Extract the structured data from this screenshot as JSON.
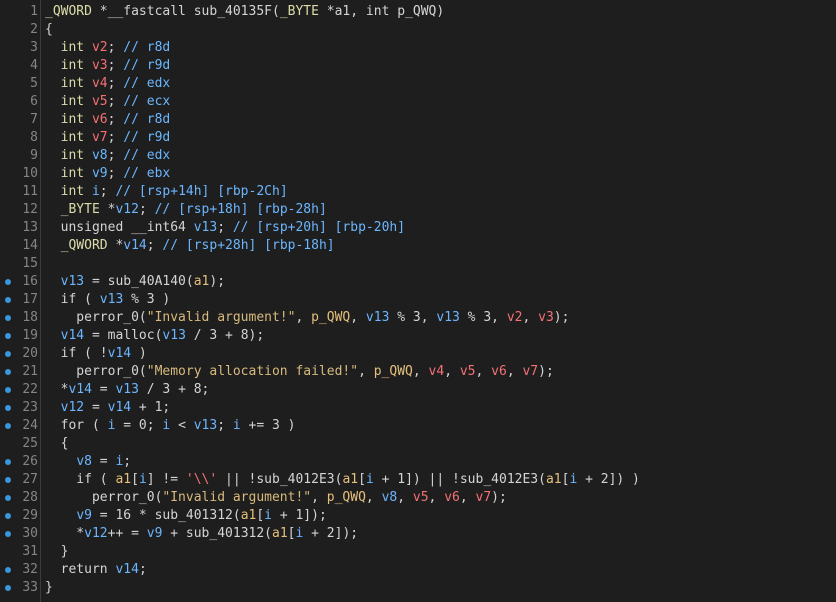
{
  "colors": {
    "background": "#1e1e1e",
    "line_number": "#858585",
    "breakpoint_dot": "#3a96dd",
    "keyword": "#dcdcaa",
    "local_var": "#6cb6ff",
    "argument": "#e5c07b",
    "register_var": "#f47174",
    "string": "#d7ba7d"
  },
  "lines": [
    {
      "n": "1",
      "dot": false,
      "tokens": [
        [
          "typ",
          "_QWORD"
        ],
        [
          "plain",
          " *__fastcall sub_40135F("
        ],
        [
          "typ",
          "_BYTE"
        ],
        [
          "plain",
          " *a1, int p_QWQ)"
        ]
      ]
    },
    {
      "n": "2",
      "dot": false,
      "tokens": [
        [
          "plain",
          "{"
        ]
      ]
    },
    {
      "n": "3",
      "dot": false,
      "tokens": [
        [
          "plain",
          "  "
        ],
        [
          "kw",
          "int"
        ],
        [
          "plain",
          " "
        ],
        [
          "reg",
          "v2"
        ],
        [
          "plain",
          "; "
        ],
        [
          "com",
          "// r8d"
        ]
      ]
    },
    {
      "n": "4",
      "dot": false,
      "tokens": [
        [
          "plain",
          "  "
        ],
        [
          "kw",
          "int"
        ],
        [
          "plain",
          " "
        ],
        [
          "reg",
          "v3"
        ],
        [
          "plain",
          "; "
        ],
        [
          "com",
          "// r9d"
        ]
      ]
    },
    {
      "n": "5",
      "dot": false,
      "tokens": [
        [
          "plain",
          "  "
        ],
        [
          "kw",
          "int"
        ],
        [
          "plain",
          " "
        ],
        [
          "reg",
          "v4"
        ],
        [
          "plain",
          "; "
        ],
        [
          "com",
          "// edx"
        ]
      ]
    },
    {
      "n": "6",
      "dot": false,
      "tokens": [
        [
          "plain",
          "  "
        ],
        [
          "kw",
          "int"
        ],
        [
          "plain",
          " "
        ],
        [
          "reg",
          "v5"
        ],
        [
          "plain",
          "; "
        ],
        [
          "com",
          "// ecx"
        ]
      ]
    },
    {
      "n": "7",
      "dot": false,
      "tokens": [
        [
          "plain",
          "  "
        ],
        [
          "kw",
          "int"
        ],
        [
          "plain",
          " "
        ],
        [
          "reg",
          "v6"
        ],
        [
          "plain",
          "; "
        ],
        [
          "com",
          "// r8d"
        ]
      ]
    },
    {
      "n": "8",
      "dot": false,
      "tokens": [
        [
          "plain",
          "  "
        ],
        [
          "kw",
          "int"
        ],
        [
          "plain",
          " "
        ],
        [
          "reg",
          "v7"
        ],
        [
          "plain",
          "; "
        ],
        [
          "com",
          "// r9d"
        ]
      ]
    },
    {
      "n": "9",
      "dot": false,
      "tokens": [
        [
          "plain",
          "  "
        ],
        [
          "kw",
          "int"
        ],
        [
          "plain",
          " "
        ],
        [
          "var",
          "v8"
        ],
        [
          "plain",
          "; "
        ],
        [
          "com",
          "// edx"
        ]
      ]
    },
    {
      "n": "10",
      "dot": false,
      "tokens": [
        [
          "plain",
          "  "
        ],
        [
          "kw",
          "int"
        ],
        [
          "plain",
          " "
        ],
        [
          "var",
          "v9"
        ],
        [
          "plain",
          "; "
        ],
        [
          "com",
          "// ebx"
        ]
      ]
    },
    {
      "n": "11",
      "dot": false,
      "tokens": [
        [
          "plain",
          "  "
        ],
        [
          "kw",
          "int"
        ],
        [
          "plain",
          " "
        ],
        [
          "var",
          "i"
        ],
        [
          "plain",
          "; "
        ],
        [
          "com",
          "// [rsp+14h] [rbp-2Ch]"
        ]
      ]
    },
    {
      "n": "12",
      "dot": false,
      "tokens": [
        [
          "plain",
          "  "
        ],
        [
          "typ",
          "_BYTE"
        ],
        [
          "plain",
          " *"
        ],
        [
          "var",
          "v12"
        ],
        [
          "plain",
          "; "
        ],
        [
          "com",
          "// [rsp+18h] [rbp-28h]"
        ]
      ]
    },
    {
      "n": "13",
      "dot": false,
      "tokens": [
        [
          "plain",
          "  unsigned __int64 "
        ],
        [
          "var",
          "v13"
        ],
        [
          "plain",
          "; "
        ],
        [
          "com",
          "// [rsp+20h] [rbp-20h]"
        ]
      ]
    },
    {
      "n": "14",
      "dot": false,
      "tokens": [
        [
          "plain",
          "  "
        ],
        [
          "typ",
          "_QWORD"
        ],
        [
          "plain",
          " *"
        ],
        [
          "var",
          "v14"
        ],
        [
          "plain",
          "; "
        ],
        [
          "com",
          "// [rsp+28h] [rbp-18h]"
        ]
      ]
    },
    {
      "n": "15",
      "dot": false,
      "tokens": [
        [
          "plain",
          ""
        ]
      ]
    },
    {
      "n": "16",
      "dot": true,
      "tokens": [
        [
          "plain",
          "  "
        ],
        [
          "var",
          "v13"
        ],
        [
          "plain",
          " = sub_40A140("
        ],
        [
          "arg",
          "a1"
        ],
        [
          "plain",
          ");"
        ]
      ]
    },
    {
      "n": "17",
      "dot": true,
      "tokens": [
        [
          "plain",
          "  if ( "
        ],
        [
          "var",
          "v13"
        ],
        [
          "plain",
          " % 3 )"
        ]
      ]
    },
    {
      "n": "18",
      "dot": true,
      "tokens": [
        [
          "plain",
          "    perror_0("
        ],
        [
          "str",
          "\"Invalid argument!\""
        ],
        [
          "plain",
          ", "
        ],
        [
          "arg",
          "p_QWQ"
        ],
        [
          "plain",
          ", "
        ],
        [
          "var",
          "v13"
        ],
        [
          "plain",
          " % 3, "
        ],
        [
          "var",
          "v13"
        ],
        [
          "plain",
          " % 3, "
        ],
        [
          "reg",
          "v2"
        ],
        [
          "plain",
          ", "
        ],
        [
          "reg",
          "v3"
        ],
        [
          "plain",
          ");"
        ]
      ]
    },
    {
      "n": "19",
      "dot": true,
      "tokens": [
        [
          "plain",
          "  "
        ],
        [
          "var",
          "v14"
        ],
        [
          "plain",
          " = malloc("
        ],
        [
          "var",
          "v13"
        ],
        [
          "plain",
          " / 3 + 8);"
        ]
      ]
    },
    {
      "n": "20",
      "dot": true,
      "tokens": [
        [
          "plain",
          "  if ( !"
        ],
        [
          "var",
          "v14"
        ],
        [
          "plain",
          " )"
        ]
      ]
    },
    {
      "n": "21",
      "dot": true,
      "tokens": [
        [
          "plain",
          "    perror_0("
        ],
        [
          "str",
          "\"Memory allocation failed!\""
        ],
        [
          "plain",
          ", "
        ],
        [
          "arg",
          "p_QWQ"
        ],
        [
          "plain",
          ", "
        ],
        [
          "reg",
          "v4"
        ],
        [
          "plain",
          ", "
        ],
        [
          "reg",
          "v5"
        ],
        [
          "plain",
          ", "
        ],
        [
          "reg",
          "v6"
        ],
        [
          "plain",
          ", "
        ],
        [
          "reg",
          "v7"
        ],
        [
          "plain",
          ");"
        ]
      ]
    },
    {
      "n": "22",
      "dot": true,
      "tokens": [
        [
          "plain",
          "  *"
        ],
        [
          "var",
          "v14"
        ],
        [
          "plain",
          " = "
        ],
        [
          "var",
          "v13"
        ],
        [
          "plain",
          " / 3 + 8;"
        ]
      ]
    },
    {
      "n": "23",
      "dot": true,
      "tokens": [
        [
          "plain",
          "  "
        ],
        [
          "var",
          "v12"
        ],
        [
          "plain",
          " = "
        ],
        [
          "var",
          "v14"
        ],
        [
          "plain",
          " + 1;"
        ]
      ]
    },
    {
      "n": "24",
      "dot": true,
      "tokens": [
        [
          "plain",
          "  for ( "
        ],
        [
          "var",
          "i"
        ],
        [
          "plain",
          " = 0; "
        ],
        [
          "var",
          "i"
        ],
        [
          "plain",
          " < "
        ],
        [
          "var",
          "v13"
        ],
        [
          "plain",
          "; "
        ],
        [
          "var",
          "i"
        ],
        [
          "plain",
          " += 3 )"
        ]
      ]
    },
    {
      "n": "25",
      "dot": false,
      "tokens": [
        [
          "plain",
          "  {"
        ]
      ]
    },
    {
      "n": "26",
      "dot": true,
      "tokens": [
        [
          "plain",
          "    "
        ],
        [
          "var",
          "v8"
        ],
        [
          "plain",
          " = "
        ],
        [
          "var",
          "i"
        ],
        [
          "plain",
          ";"
        ]
      ]
    },
    {
      "n": "27",
      "dot": true,
      "tokens": [
        [
          "plain",
          "    if ( "
        ],
        [
          "arg",
          "a1"
        ],
        [
          "plain",
          "["
        ],
        [
          "var",
          "i"
        ],
        [
          "plain",
          "] != "
        ],
        [
          "chr",
          "'\\\\'"
        ],
        [
          "plain",
          " || !sub_4012E3("
        ],
        [
          "arg",
          "a1"
        ],
        [
          "plain",
          "["
        ],
        [
          "var",
          "i"
        ],
        [
          "plain",
          " + 1]) || !sub_4012E3("
        ],
        [
          "arg",
          "a1"
        ],
        [
          "plain",
          "["
        ],
        [
          "var",
          "i"
        ],
        [
          "plain",
          " + 2]) )"
        ]
      ]
    },
    {
      "n": "28",
      "dot": true,
      "tokens": [
        [
          "plain",
          "      perror_0("
        ],
        [
          "str",
          "\"Invalid argument!\""
        ],
        [
          "plain",
          ", "
        ],
        [
          "arg",
          "p_QWQ"
        ],
        [
          "plain",
          ", "
        ],
        [
          "var",
          "v8"
        ],
        [
          "plain",
          ", "
        ],
        [
          "reg",
          "v5"
        ],
        [
          "plain",
          ", "
        ],
        [
          "reg",
          "v6"
        ],
        [
          "plain",
          ", "
        ],
        [
          "reg",
          "v7"
        ],
        [
          "plain",
          ");"
        ]
      ]
    },
    {
      "n": "29",
      "dot": true,
      "tokens": [
        [
          "plain",
          "    "
        ],
        [
          "var",
          "v9"
        ],
        [
          "plain",
          " = 16 * sub_401312("
        ],
        [
          "arg",
          "a1"
        ],
        [
          "plain",
          "["
        ],
        [
          "var",
          "i"
        ],
        [
          "plain",
          " + 1]);"
        ]
      ]
    },
    {
      "n": "30",
      "dot": true,
      "tokens": [
        [
          "plain",
          "    *"
        ],
        [
          "var",
          "v12"
        ],
        [
          "plain",
          "++ = "
        ],
        [
          "var",
          "v9"
        ],
        [
          "plain",
          " + sub_401312("
        ],
        [
          "arg",
          "a1"
        ],
        [
          "plain",
          "["
        ],
        [
          "var",
          "i"
        ],
        [
          "plain",
          " + 2]);"
        ]
      ]
    },
    {
      "n": "31",
      "dot": false,
      "tokens": [
        [
          "plain",
          "  }"
        ]
      ]
    },
    {
      "n": "32",
      "dot": true,
      "tokens": [
        [
          "plain",
          "  return "
        ],
        [
          "var",
          "v14"
        ],
        [
          "plain",
          ";"
        ]
      ]
    },
    {
      "n": "33",
      "dot": true,
      "tokens": [
        [
          "plain",
          "}"
        ]
      ]
    }
  ]
}
